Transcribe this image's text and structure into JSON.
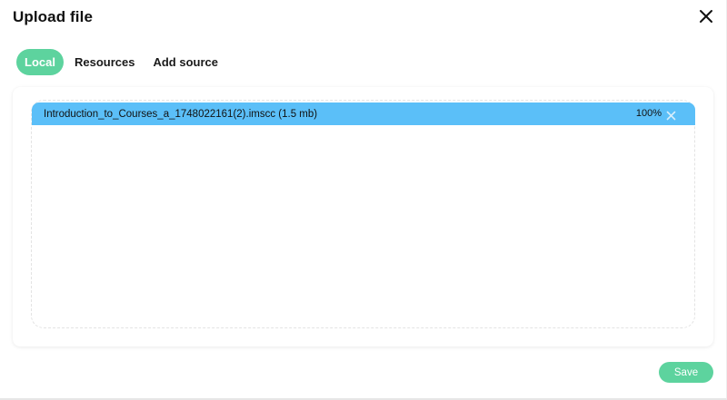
{
  "dialog": {
    "title": "Upload file"
  },
  "tabs": [
    {
      "label": "Local",
      "active": true
    },
    {
      "label": "Resources",
      "active": false
    },
    {
      "label": "Add source",
      "active": false
    }
  ],
  "upload": {
    "file_label": "Introduction_to_Courses_a_1748022161(2).imscc (1.5 mb)",
    "progress_text": "100%",
    "progress": 1.0
  },
  "footer": {
    "save_label": "Save"
  },
  "colors": {
    "accent": "#5dd39e",
    "file_bar": "#5bbff8"
  },
  "icons": {
    "close": "close-icon",
    "remove_file": "close-icon"
  }
}
